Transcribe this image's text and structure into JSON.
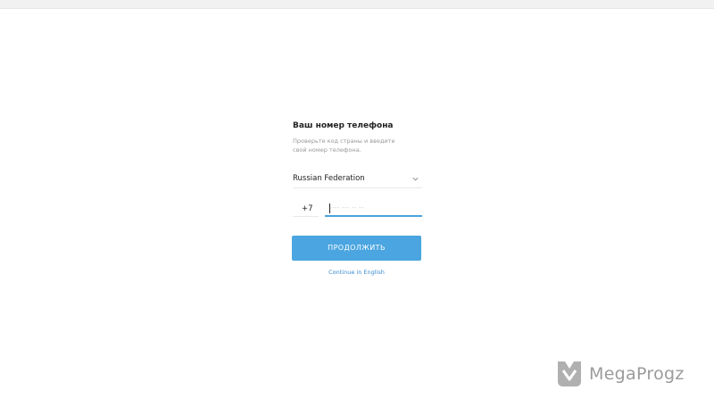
{
  "login": {
    "title": "Ваш номер телефона",
    "description": "Проверьте код страны и введите свой номер телефона.",
    "country": {
      "selected": "Russian Federation",
      "icon": "chevron-down-icon"
    },
    "phone": {
      "country_code": "+7",
      "placeholder": "--- --- -- --"
    },
    "next_button_label": "ПРОДОЛЖИТЬ",
    "english_link": "Continue in English"
  },
  "colors": {
    "accent": "#4aa5e0",
    "link": "#3a8bd0",
    "field_active_underline": "#4aa2dc"
  },
  "watermark": {
    "text": "MegaProgz",
    "icon": "megaprogz-logo-icon"
  }
}
